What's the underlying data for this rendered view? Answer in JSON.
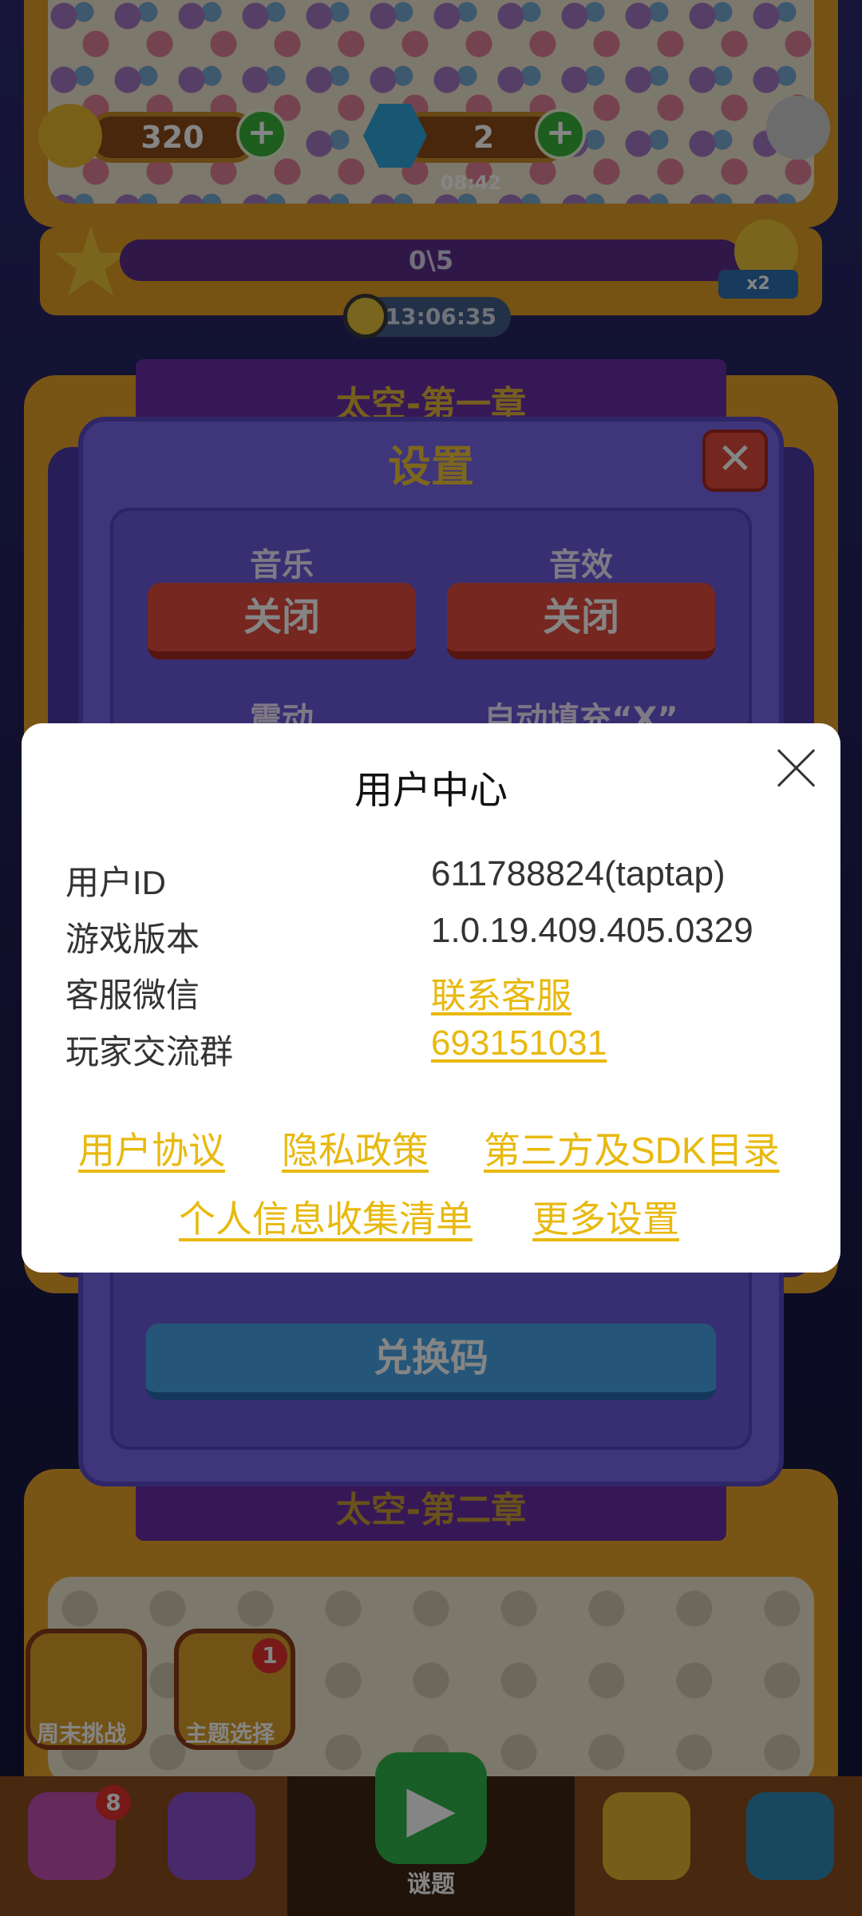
{
  "game": {
    "coins": "320",
    "gems": "2",
    "small_timer": "08:42",
    "progress_text": "0\\5",
    "multiplier": "x2",
    "countdown": "13:06:35",
    "chapter_title": "太空-第一章",
    "chapter2_title": "太空-第二章",
    "weekend_challenge": "周末挑战",
    "theme_select": "主题选择",
    "theme_badge": "1",
    "nav_badge": "8",
    "nav_puzzle": "谜题"
  },
  "settings": {
    "title": "设置",
    "music_label": "音乐",
    "music_value": "关闭",
    "sound_label": "音效",
    "sound_value": "关闭",
    "vibration_label": "震动",
    "autofill_label": "自动填充“X”",
    "redeem_label": "兑换码"
  },
  "user_center": {
    "title": "用户中心",
    "rows": [
      {
        "label": "用户ID",
        "value": "611788824(taptap)"
      },
      {
        "label": "游戏版本",
        "value": "1.0.19.409.405.0329"
      },
      {
        "label": "客服微信",
        "value": "联系客服"
      },
      {
        "label": "玩家交流群",
        "value": "693151031"
      }
    ],
    "links": {
      "user_agreement": "用户协议",
      "privacy_policy": "隐私政策",
      "third_party_sdk": "第三方及SDK目录",
      "personal_info": "个人信息收集清单",
      "more_settings": "更多设置"
    }
  },
  "colors": {
    "link": "#e8b90e",
    "settings_panel": "#7766ea",
    "red_button": "#e14b3e",
    "blue_button": "#47a5e8"
  }
}
